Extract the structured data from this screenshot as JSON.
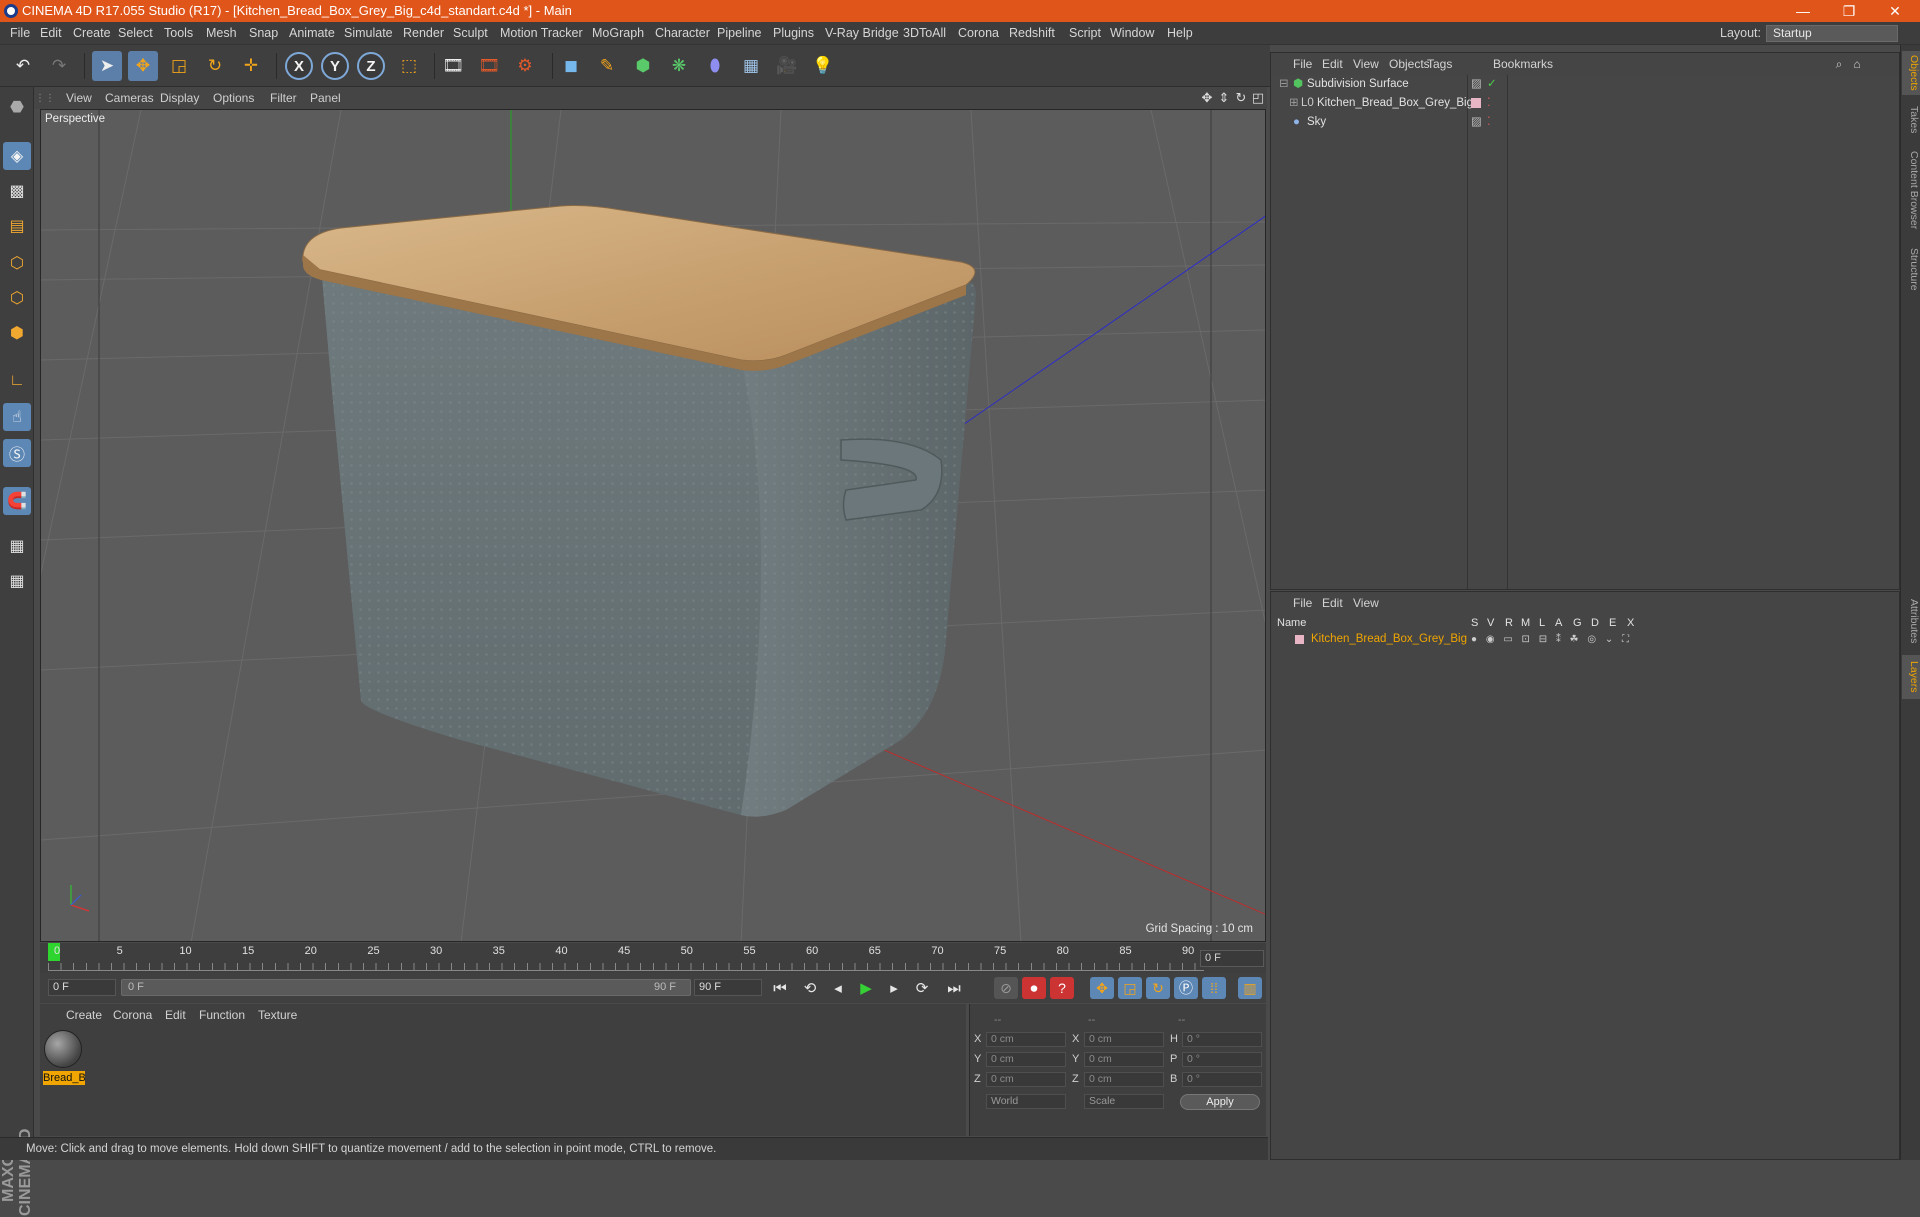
{
  "window": {
    "title": "CINEMA 4D R17.055 Studio (R17) - [Kitchen_Bread_Box_Grey_Big_c4d_standart.c4d *] - Main",
    "minimize": "—",
    "restore": "❐",
    "close": "✕"
  },
  "menubar": {
    "items": [
      "File",
      "Edit",
      "Create",
      "Select",
      "Tools",
      "Mesh",
      "Snap",
      "Animate",
      "Simulate",
      "Render",
      "Sculpt",
      "Motion Tracker",
      "MoGraph",
      "Character",
      "Pipeline",
      "Plugins",
      "V-Ray Bridge",
      "3DToAll",
      "Corona",
      "Redshift",
      "Script",
      "Window",
      "Help"
    ],
    "layout_label": "Layout:",
    "layout_value": "Startup"
  },
  "toolbar": {
    "axis_x": "X",
    "axis_y": "Y",
    "axis_z": "Z"
  },
  "viewport": {
    "menu": [
      "View",
      "Cameras",
      "Display",
      "Options",
      "Filter",
      "Panel"
    ],
    "label": "Perspective",
    "grid_spacing": "Grid Spacing : 10 cm"
  },
  "timeline": {
    "ticks": [
      "0",
      "5",
      "10",
      "15",
      "20",
      "25",
      "30",
      "35",
      "40",
      "45",
      "50",
      "55",
      "60",
      "65",
      "70",
      "75",
      "80",
      "85",
      "90"
    ],
    "current_frame": "0 F",
    "start_field": "0 F",
    "range_start": "0 F",
    "range_end": "90 F",
    "end_field": "90 F"
  },
  "material_manager": {
    "menu": [
      "Create",
      "Corona",
      "Edit",
      "Function",
      "Texture"
    ],
    "materials": [
      {
        "name": "Bread_B"
      }
    ]
  },
  "coordinates": {
    "headers": [
      "--",
      "--",
      "--"
    ],
    "rows": [
      {
        "l1": "X",
        "v1": "0 cm",
        "l2": "X",
        "v2": "0 cm",
        "l3": "H",
        "v3": "0 °"
      },
      {
        "l1": "Y",
        "v1": "0 cm",
        "l2": "Y",
        "v2": "0 cm",
        "l3": "P",
        "v3": "0 °"
      },
      {
        "l1": "Z",
        "v1": "0 cm",
        "l2": "Z",
        "v2": "0 cm",
        "l3": "B",
        "v3": "0 °"
      }
    ],
    "mode_world": "World",
    "mode_scale": "Scale",
    "apply": "Apply"
  },
  "status": "Move: Click and drag to move elements. Hold down SHIFT to quantize movement / add to the selection in point mode, CTRL to remove.",
  "object_manager": {
    "menu": [
      "File",
      "Edit",
      "View",
      "Objects",
      "Tags",
      "Bookmarks"
    ],
    "objects": [
      {
        "name": "Subdivision Surface"
      },
      {
        "name": "Kitchen_Bread_Box_Grey_Big"
      },
      {
        "name": "Sky"
      }
    ]
  },
  "layer_manager": {
    "menu": [
      "File",
      "Edit",
      "View"
    ],
    "columns": [
      "Name",
      "S",
      "V",
      "R",
      "M",
      "L",
      "A",
      "G",
      "D",
      "E",
      "X"
    ],
    "layers": [
      {
        "name": "Kitchen_Bread_Box_Grey_Big",
        "color": "#f0a500"
      }
    ]
  },
  "side_tabs": [
    "Objects",
    "Takes",
    "Content Browser",
    "Structure",
    "Attributes",
    "Layers"
  ],
  "colors": {
    "accent_orange": "#e0551a",
    "highlight_yellow": "#f0a500",
    "tool_blue": "#5d87b5"
  }
}
